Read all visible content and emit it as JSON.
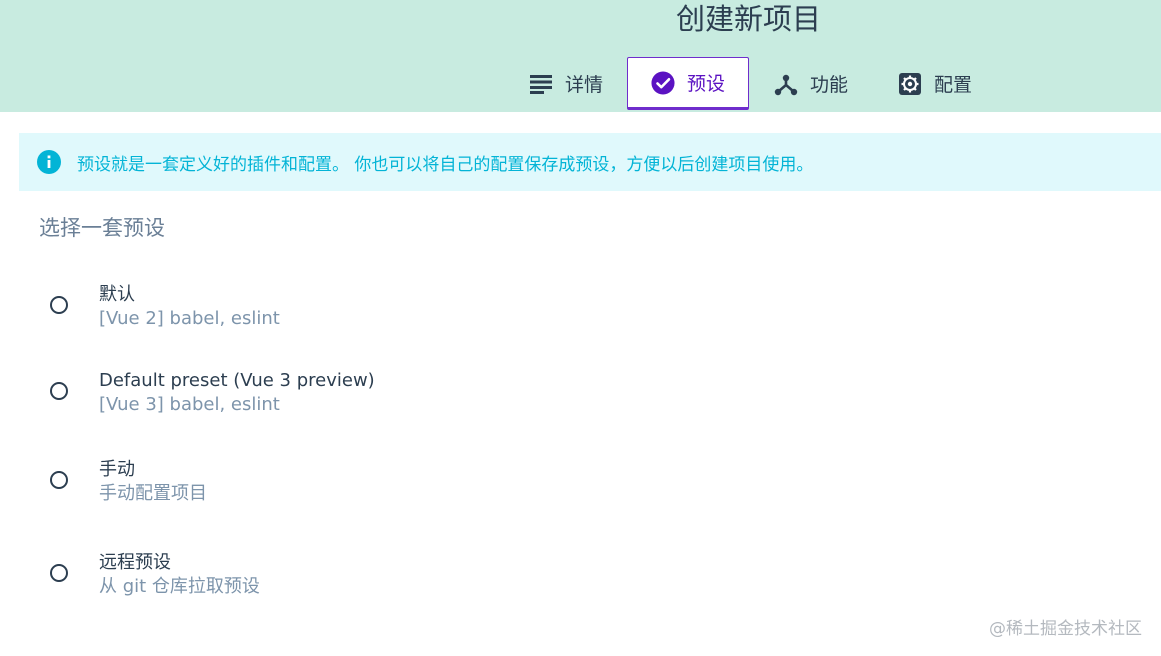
{
  "header": {
    "title": "创建新项目"
  },
  "tabs": [
    {
      "label": "详情",
      "icon": "list-icon",
      "active": false
    },
    {
      "label": "预设",
      "icon": "check-circle-icon",
      "active": true
    },
    {
      "label": "功能",
      "icon": "fork-icon",
      "active": false
    },
    {
      "label": "配置",
      "icon": "gear-icon",
      "active": false
    }
  ],
  "info": {
    "text": "预设就是一套定义好的插件和配置。 你也可以将自己的配置保存成预设，方便以后创建项目使用。"
  },
  "presets": {
    "title": "选择一套预设",
    "options": [
      {
        "label": "默认",
        "description": "[Vue 2] babel, eslint",
        "selected": false
      },
      {
        "label": "Default preset (Vue 3 preview)",
        "description": "[Vue 3] babel, eslint",
        "selected": false
      },
      {
        "label": "手动",
        "description": "手动配置项目",
        "selected": false
      },
      {
        "label": "远程预设",
        "description": "从 git 仓库拉取预设",
        "selected": false
      }
    ]
  },
  "watermark": "@稀土掘金技术社区",
  "colors": {
    "header_bg": "#c8ebe0",
    "accent": "#6f2dcc",
    "info_bg": "#e0f9fc",
    "info_text": "#03b4d6",
    "text": "#2c3e50",
    "muted": "#7d94ab"
  }
}
